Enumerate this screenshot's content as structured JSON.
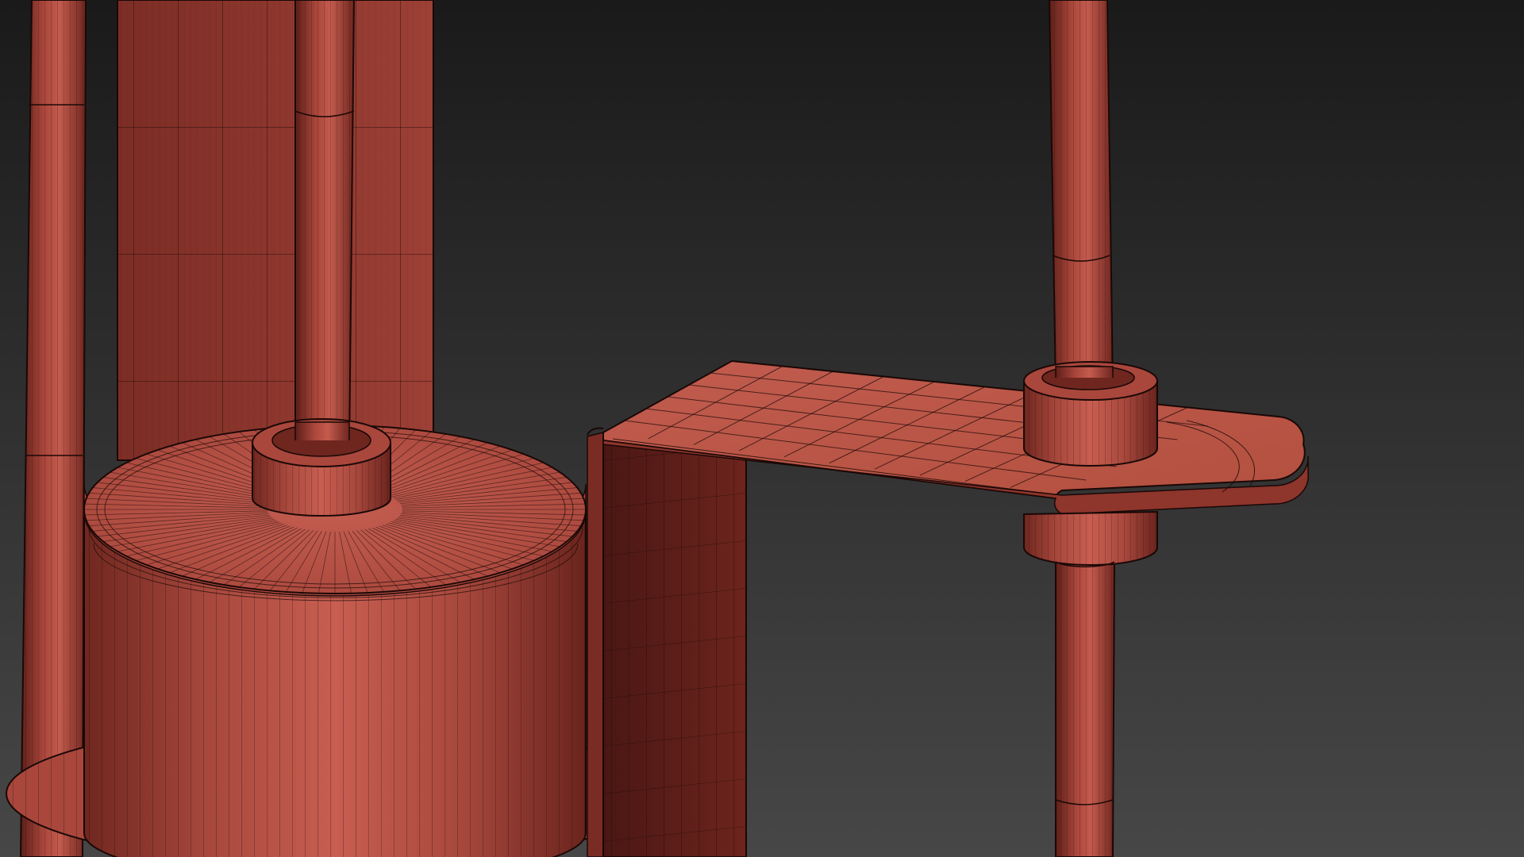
{
  "viewport": {
    "shading": "edged-faces",
    "background_top": "#1a1a1a",
    "background_bottom": "#474747"
  },
  "materials": {
    "clay_light": "#c0574a",
    "clay_mid": "#a8483d",
    "clay_dark": "#7a2c24",
    "clay_shadow": "#5a1d18",
    "wire": "#1a0806"
  },
  "scene_objects": [
    "left-rod",
    "back-panel",
    "center-rod",
    "weight-cylinder",
    "center-collar",
    "base-plate",
    "bracket-upright",
    "bracket-arm",
    "right-rod",
    "right-collar-top",
    "right-collar-bottom"
  ]
}
